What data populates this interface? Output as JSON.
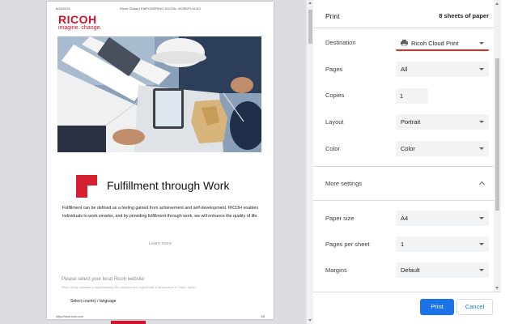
{
  "preview": {
    "header_date": "8/16/2021",
    "header_title": "Ricoh Global | EMPOWERING DIGITAL WORKPLACES",
    "logo": "RICOH",
    "tagline": "imagine. change.",
    "headline": "Fulfillment through Work",
    "body": "Fulfillment can be defined as a feeling gained from achievement and self-development. RICOH enables individuals to work smarter, and by providing fulfillment through work, we will enhance the quality of life.",
    "learn_more": "Learn more",
    "select_title": "Please select your local Ricoh website",
    "select_sub": "Ricoh Group operates in approximately 200 countries and regions with a headquarter in Tokyo, Japan.",
    "select_country": "Select country / language",
    "footer_url": "https://www.ricoh.com",
    "footer_page": "1/6"
  },
  "print": {
    "title": "Print",
    "sheets": "8 sheets of paper",
    "destination": {
      "label": "Destination",
      "value": "Ricoh Cloud Print",
      "icon": "printer-icon"
    },
    "pages": {
      "label": "Pages",
      "value": "All"
    },
    "copies": {
      "label": "Copies",
      "value": "1"
    },
    "layout": {
      "label": "Layout",
      "value": "Portrait"
    },
    "color": {
      "label": "Color",
      "value": "Color"
    },
    "more_settings": "More settings",
    "paper_size": {
      "label": "Paper size",
      "value": "A4"
    },
    "pages_per_sheet": {
      "label": "Pages per sheet",
      "value": "1"
    },
    "margins": {
      "label": "Margins",
      "value": "Default"
    },
    "print_button": "Print",
    "cancel_button": "Cancel"
  },
  "colors": {
    "brand_red": "#cf142b",
    "accent_blue": "#1a73e8",
    "destination_underline": "#d93025"
  }
}
